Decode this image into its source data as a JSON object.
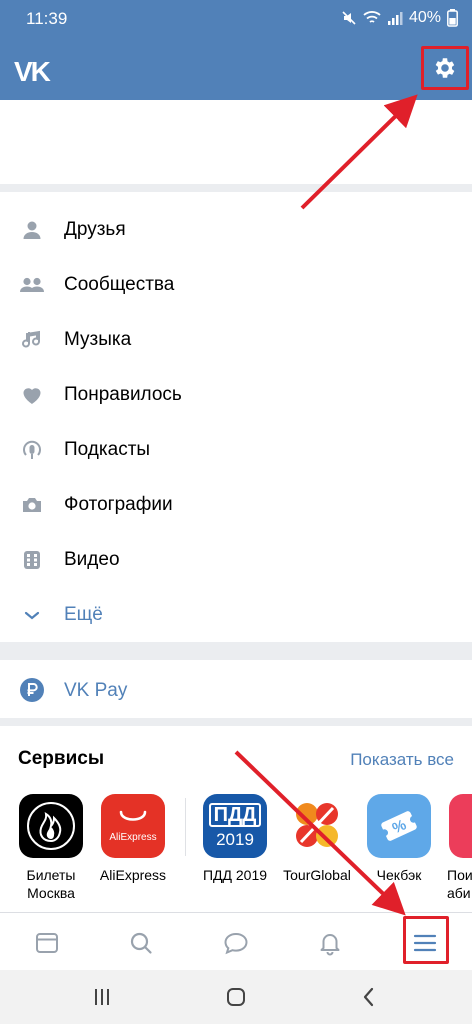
{
  "status": {
    "time": "11:39",
    "battery": "40%"
  },
  "header": {
    "logo": "VK"
  },
  "menu": {
    "items": [
      {
        "label": "Друзья",
        "icon": "person-icon"
      },
      {
        "label": "Сообщества",
        "icon": "people-icon"
      },
      {
        "label": "Музыка",
        "icon": "music-note-icon"
      },
      {
        "label": "Понравилось",
        "icon": "heart-icon"
      },
      {
        "label": "Подкасты",
        "icon": "podcast-icon"
      },
      {
        "label": "Фотографии",
        "icon": "camera-icon"
      },
      {
        "label": "Видео",
        "icon": "film-icon"
      },
      {
        "label": "Ещё",
        "icon": "chevron-down-icon"
      }
    ]
  },
  "vkpay": {
    "label": "VK Pay",
    "icon": "ruble-icon"
  },
  "services": {
    "title": "Сервисы",
    "show_all": "Показать все",
    "items": [
      {
        "line1": "Билеты",
        "line2": "Москва"
      },
      {
        "line1": "AliExpress",
        "line2": "",
        "tile_text": "AliExpress"
      },
      {
        "line1": "ПДД 2019",
        "line2": "",
        "tile_text1": "ПДД",
        "tile_text2": "2019"
      },
      {
        "line1": "TourGlobal",
        "line2": ""
      },
      {
        "line1": "Чекбэк",
        "line2": "",
        "tile_text": "%"
      },
      {
        "line1": "Пои",
        "line2": "аби"
      }
    ]
  },
  "colors": {
    "accent": "#5181b8",
    "highlight": "#e0202a",
    "icon_gray": "#99a2ad"
  }
}
